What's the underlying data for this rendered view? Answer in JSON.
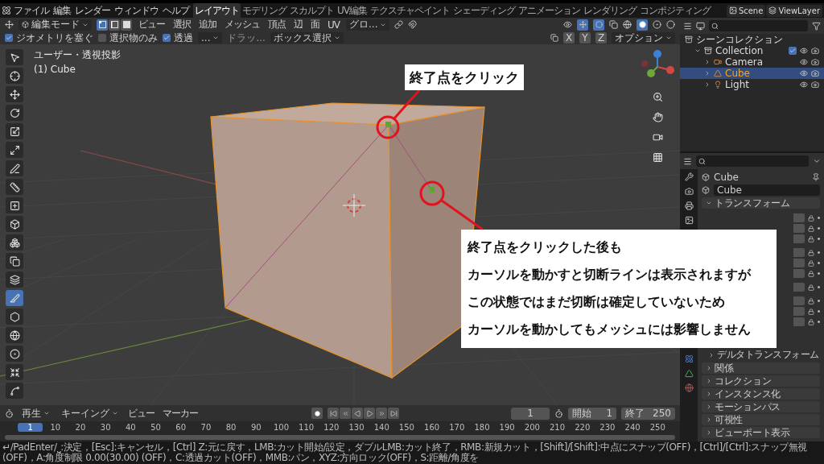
{
  "topbar": {
    "menus": [
      "ファイル",
      "編集",
      "レンダー",
      "ウィンドウ",
      "ヘルプ"
    ],
    "workspaces": [
      {
        "label": "レイアウト",
        "selected": true
      },
      {
        "label": "モデリング",
        "selected": false
      },
      {
        "label": "スカルプト",
        "selected": false
      },
      {
        "label": "UV編集",
        "selected": false
      },
      {
        "label": "テクスチャペイント",
        "selected": false
      },
      {
        "label": "シェーディング",
        "selected": false
      },
      {
        "label": "アニメーション",
        "selected": false
      },
      {
        "label": "レンダリング",
        "selected": false
      },
      {
        "label": "コンポジティング",
        "selected": false
      }
    ],
    "scene": "Scene",
    "view_layer": "ViewLayer"
  },
  "viewport_header": {
    "mode": "編集モード",
    "select_modes": [
      {
        "selected": true
      },
      {
        "selected": false
      },
      {
        "selected": false
      }
    ],
    "menus": [
      "ビュー",
      "選択",
      "追加",
      "メッシュ",
      "頂点",
      "辺",
      "面",
      "UV"
    ],
    "orientation": "グロ...",
    "options": [
      {
        "label": "ジオメトリを塞ぐ",
        "checked": true
      },
      {
        "label": "選択物のみ",
        "checked": false
      },
      {
        "label": "透過",
        "checked": true
      }
    ],
    "extra_dropdown": "...",
    "drag_label": "ドラッ...",
    "drag_value": "ボックス選択",
    "axes": [
      "X",
      "Y",
      "Z"
    ],
    "options_menu": "オプション"
  },
  "viewport": {
    "view_name": "ユーザー・透視投影",
    "object_name": "(1) Cube",
    "tools": [
      {
        "selected": false
      },
      {
        "selected": false
      },
      {
        "selected": false
      },
      {
        "selected": false
      },
      {
        "selected": false
      },
      {
        "selected": false
      },
      {
        "selected": false
      },
      {
        "selected": false
      },
      {
        "selected": false
      },
      {
        "selected": false
      },
      {
        "selected": false
      },
      {
        "selected": false
      },
      {
        "selected": false
      },
      {
        "selected": true
      },
      {
        "selected": false
      },
      {
        "selected": false
      },
      {
        "selected": false
      },
      {
        "selected": false
      },
      {
        "selected": false
      }
    ]
  },
  "annotations": [
    {
      "kind": "label",
      "text": "終了点をクリック"
    },
    {
      "kind": "note",
      "lines": [
        "終了点をクリックした後も",
        "カーソルを動かすと切断ラインは表示されますが",
        "この状態ではまだ切断は確定していないため",
        "カーソルを動かしてもメッシュには影響しません"
      ]
    }
  ],
  "outliner": {
    "root": "シーンコレクション",
    "items": [
      {
        "name": "Collection",
        "kind": "collection",
        "expanded": true,
        "checked": true,
        "selected": false,
        "children": [
          {
            "name": "Camera",
            "kind": "camera",
            "expanded": false,
            "selected": false
          },
          {
            "name": "Cube",
            "kind": "mesh",
            "expanded": false,
            "selected": true
          },
          {
            "name": "Light",
            "kind": "light",
            "expanded": false,
            "selected": false
          }
        ]
      }
    ]
  },
  "properties": {
    "object_title": "Cube",
    "object_name": "Cube",
    "panels": [
      {
        "label": "トランスフォーム",
        "expanded": true,
        "children": [
          {
            "label": "デルタトランスフォーム",
            "expanded": false
          }
        ]
      },
      {
        "label": "関係",
        "expanded": false
      },
      {
        "label": "コレクション",
        "expanded": false
      },
      {
        "label": "インスタンス化",
        "expanded": false
      },
      {
        "label": "モーションパス",
        "expanded": false
      },
      {
        "label": "可視性",
        "expanded": false
      },
      {
        "label": "ビューポート表示",
        "expanded": false
      }
    ]
  },
  "timeline": {
    "menus": [
      {
        "label": "再生",
        "kind": "dropdown"
      },
      {
        "label": "キーイング",
        "kind": "dropdown"
      },
      {
        "label": "ビュー",
        "kind": "menu"
      },
      {
        "label": "マーカー",
        "kind": "menu"
      }
    ],
    "current_frame": "1",
    "start_label": "開始",
    "start": "1",
    "end_label": "終了",
    "end": "250",
    "ticks": [
      {
        "label": "1",
        "selected": true
      },
      {
        "label": "10",
        "selected": false
      },
      {
        "label": "20",
        "selected": false
      },
      {
        "label": "30",
        "selected": false
      },
      {
        "label": "40",
        "selected": false
      },
      {
        "label": "50",
        "selected": false
      },
      {
        "label": "60",
        "selected": false
      },
      {
        "label": "70",
        "selected": false
      },
      {
        "label": "80",
        "selected": false
      },
      {
        "label": "90",
        "selected": false
      },
      {
        "label": "100",
        "selected": false
      },
      {
        "label": "110",
        "selected": false
      },
      {
        "label": "120",
        "selected": false
      },
      {
        "label": "130",
        "selected": false
      },
      {
        "label": "140",
        "selected": false
      },
      {
        "label": "150",
        "selected": false
      },
      {
        "label": "160",
        "selected": false
      },
      {
        "label": "170",
        "selected": false
      },
      {
        "label": "180",
        "selected": false
      },
      {
        "label": "190",
        "selected": false
      },
      {
        "label": "200",
        "selected": false
      },
      {
        "label": "210",
        "selected": false
      },
      {
        "label": "220",
        "selected": false
      },
      {
        "label": "230",
        "selected": false
      },
      {
        "label": "240",
        "selected": false
      },
      {
        "label": "250",
        "selected": false
      }
    ]
  },
  "status_bar": "↵/PadEnter/⎵:決定，[Esc]:キャンセル，[Ctrl] Z:元に戻す，LMB:カット開始/設定，ダブルLMB:カット終了，RMB:新規カット，[Shift]/[Shift]:中点にスナップ(OFF)，[Ctrl]/[Ctrl]:スナップ無視(OFF)，A:角度制限 0.00(30.00) (OFF)，C:透過カット(OFF)，MMB:パン，XYZ:方向ロック(OFF)，S:距離/角度を"
}
